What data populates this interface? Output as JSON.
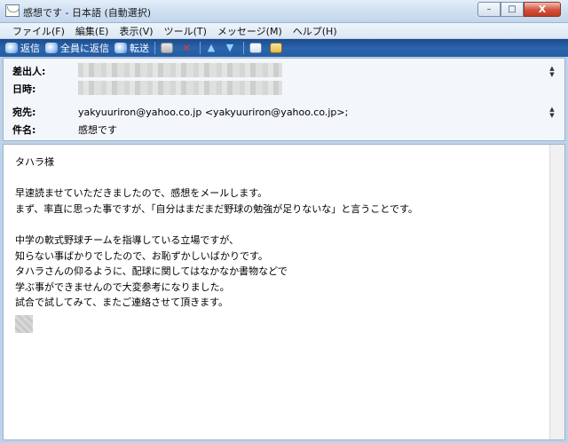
{
  "window": {
    "title": "感想です - 日本語 (自動選択)",
    "controls": {
      "minimize": "–",
      "maximize": "□",
      "close": "X"
    }
  },
  "menu": [
    "ファイル(F)",
    "編集(E)",
    "表示(V)",
    "ツール(T)",
    "メッセージ(M)",
    "ヘルプ(H)"
  ],
  "toolbar": {
    "reply": "返信",
    "reply_all": "全員に返信",
    "forward": "転送"
  },
  "header": {
    "from_label": "差出人:",
    "date_label": "日時:",
    "to_label": "宛先:",
    "to_value": "yakyuuriron@yahoo.co.jp <yakyuuriron@yahoo.co.jp>;",
    "subject_label": "件名:",
    "subject_value": "感想です"
  },
  "message": {
    "body": "タハラ様\n\n早速読ませていただきましたので、感想をメールします。\nまず、率直に思った事ですが、「自分はまだまだ野球の勉強が足りないな」と言うことです。\n\n中学の軟式野球チームを指導している立場ですが、\n知らない事ばかりでしたので、お恥ずかしいばかりです。\nタハラさんの仰るように、配球に関してはなかなか書物などで\n学ぶ事ができませんので大変参考になりました。\n試合で試してみて、またご連絡させて頂きます。"
  },
  "colors": {
    "toolbar": "#2b64ad",
    "close_button": "#d2503a"
  }
}
